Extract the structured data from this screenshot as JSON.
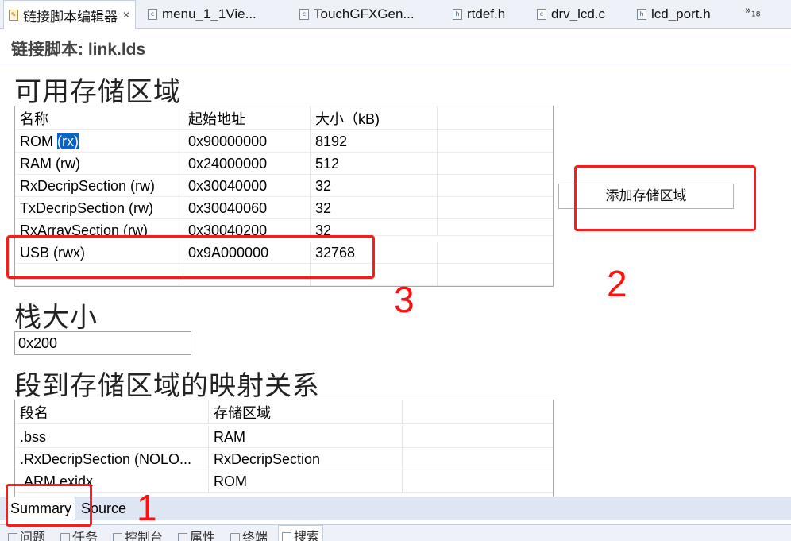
{
  "tabs": [
    {
      "label": "链接脚本编辑器",
      "icon": "pencil-file-icon",
      "active": true,
      "close": "✕"
    },
    {
      "label": "menu_1_1Vie...",
      "icon": "c-file-icon"
    },
    {
      "label": "TouchGFXGen...",
      "icon": "c-file-icon"
    },
    {
      "label": "rtdef.h",
      "icon": "h-file-icon"
    },
    {
      "label": "drv_lcd.c",
      "icon": "c-file-icon"
    },
    {
      "label": "lcd_port.h",
      "icon": "h-file-icon"
    }
  ],
  "tab_overflow": {
    "symbol": "»",
    "count": "18"
  },
  "editor": {
    "title": "链接脚本: link.lds"
  },
  "memory": {
    "title": "可用存储区域",
    "headers": [
      "名称",
      "起始地址",
      "大小（kB)"
    ],
    "rows": [
      {
        "name": "ROM",
        "perm": "(rx)",
        "address": "0x90000000",
        "size": "8192"
      },
      {
        "name": "RAM (rw)",
        "address": "0x24000000",
        "size": "512"
      },
      {
        "name": "RxDecripSection (rw)",
        "address": "0x30040000",
        "size": "32"
      },
      {
        "name": "TxDecripSection (rw)",
        "address": "0x30040060",
        "size": "32"
      },
      {
        "name": "RxArraySection (rw)",
        "address": "0x30040200",
        "size": "32"
      },
      {
        "name": "USB (rwx)",
        "address": "0x9A000000",
        "size": "32768"
      }
    ],
    "add_button": "添加存储区域"
  },
  "stack": {
    "title": "栈大小",
    "value": "0x200"
  },
  "mapping": {
    "title": "段到存储区域的映射关系",
    "headers": [
      "段名",
      "存储区域"
    ],
    "rows": [
      {
        "section": ".bss",
        "region": "RAM"
      },
      {
        "section": ".RxDecripSection (NOLO...",
        "region": "RxDecripSection"
      },
      {
        "section": ".ARM.exidx",
        "region": "ROM"
      }
    ]
  },
  "page_tabs": [
    {
      "label": "Summary",
      "active": true
    },
    {
      "label": "Source"
    }
  ],
  "bottom_views": [
    "问题",
    "任务",
    "控制台",
    "属性",
    "终端",
    "搜索"
  ],
  "annotations": [
    "1",
    "2",
    "3"
  ],
  "colors": {
    "annotation": "#ff1a1a",
    "selection": "#0a64c8"
  }
}
